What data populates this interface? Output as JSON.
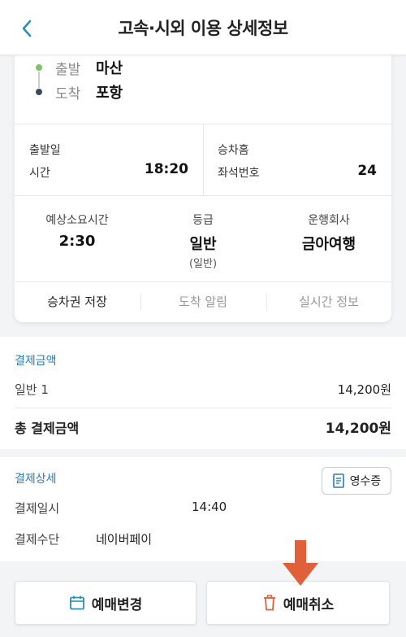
{
  "header": {
    "title": "고속·시외 이용 상세정보"
  },
  "route": {
    "departure_label": "출발",
    "departure_value": "마산",
    "arrival_label": "도착",
    "arrival_value": "포항"
  },
  "details": {
    "date_label": "출발일",
    "time_label": "시간",
    "time_value": "18:20",
    "platform_label": "승차홈",
    "seat_label": "좌석번호",
    "seat_value": "24"
  },
  "summary": {
    "duration_label": "예상소요시간",
    "duration_value": "2:30",
    "grade_label": "등급",
    "grade_value": "일반",
    "grade_sub": "(일반)",
    "company_label": "운행회사",
    "company_value": "금아여행"
  },
  "actions": {
    "save_ticket": "승차권 저장",
    "arrival_alert": "도착 알림",
    "realtime_info": "실시간 정보"
  },
  "payment": {
    "title": "결제금액",
    "item_label": "일반 1",
    "item_value": "14,200원",
    "total_label": "총 결제금액",
    "total_value": "14,200원"
  },
  "payment_detail": {
    "title": "결제상세",
    "receipt_label": "영수증",
    "datetime_label": "결제일시",
    "datetime_value": "14:40",
    "method_label": "결제수단",
    "method_value": "네이버페이"
  },
  "buttons": {
    "change_label": "예매변경",
    "cancel_label": "예매취소"
  },
  "colors": {
    "accent": "#2b7bb4",
    "arrow": "#e0603a",
    "route_start": "#7cc36a",
    "route_end": "#3b4a5a"
  }
}
